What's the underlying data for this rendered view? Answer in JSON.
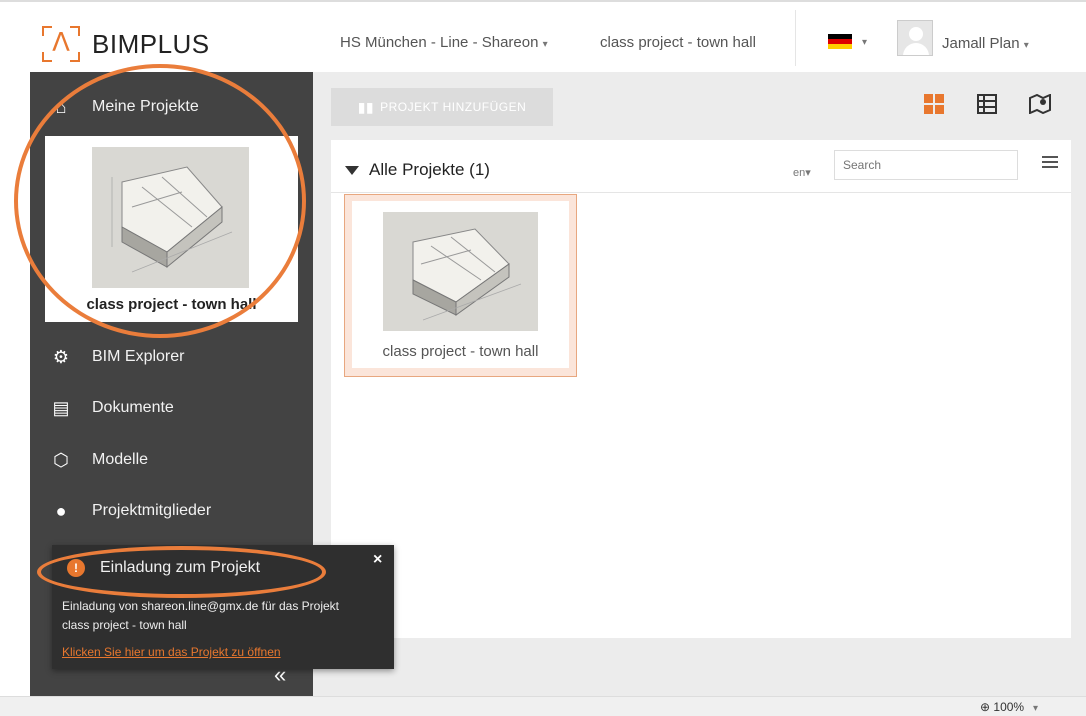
{
  "header": {
    "logo_text": "BIMPLUS",
    "team": "HS München - Line - Shareon",
    "project": "class project - town hall",
    "user": "Jamall Plan",
    "caret": "▾"
  },
  "sidebar": {
    "items": [
      {
        "label": "Meine Projekte",
        "icon": "home-icon"
      },
      {
        "label": "BIM Explorer",
        "icon": "bim-explorer-icon"
      },
      {
        "label": "Dokumente",
        "icon": "document-icon"
      },
      {
        "label": "Modelle",
        "icon": "model-cube-icon"
      },
      {
        "label": "Projektmitglieder",
        "icon": "person-icon"
      }
    ],
    "current_project": "class project - town hall",
    "collapse_glyph": "«"
  },
  "toolbar": {
    "add_project_label": "PROJEKT HINZUFÜGEN"
  },
  "panel": {
    "title": "Alle Projekte (1)",
    "sort_fragment": "en▾",
    "search_placeholder": "Search"
  },
  "projects": [
    {
      "name": "class project - town hall"
    }
  ],
  "notification": {
    "title": "Einladung zum Projekt",
    "body_line1": "Einladung von shareon.line@gmx.de für das Projekt",
    "body_line2": "class project - town hall",
    "link": "Klicken Sie hier um das Projekt zu öffnen",
    "close": "×"
  },
  "statusbar": {
    "zoom": "100%"
  },
  "colors": {
    "accent": "#e8772e",
    "sidebar_bg": "#434343",
    "main_bg": "#ececec"
  }
}
